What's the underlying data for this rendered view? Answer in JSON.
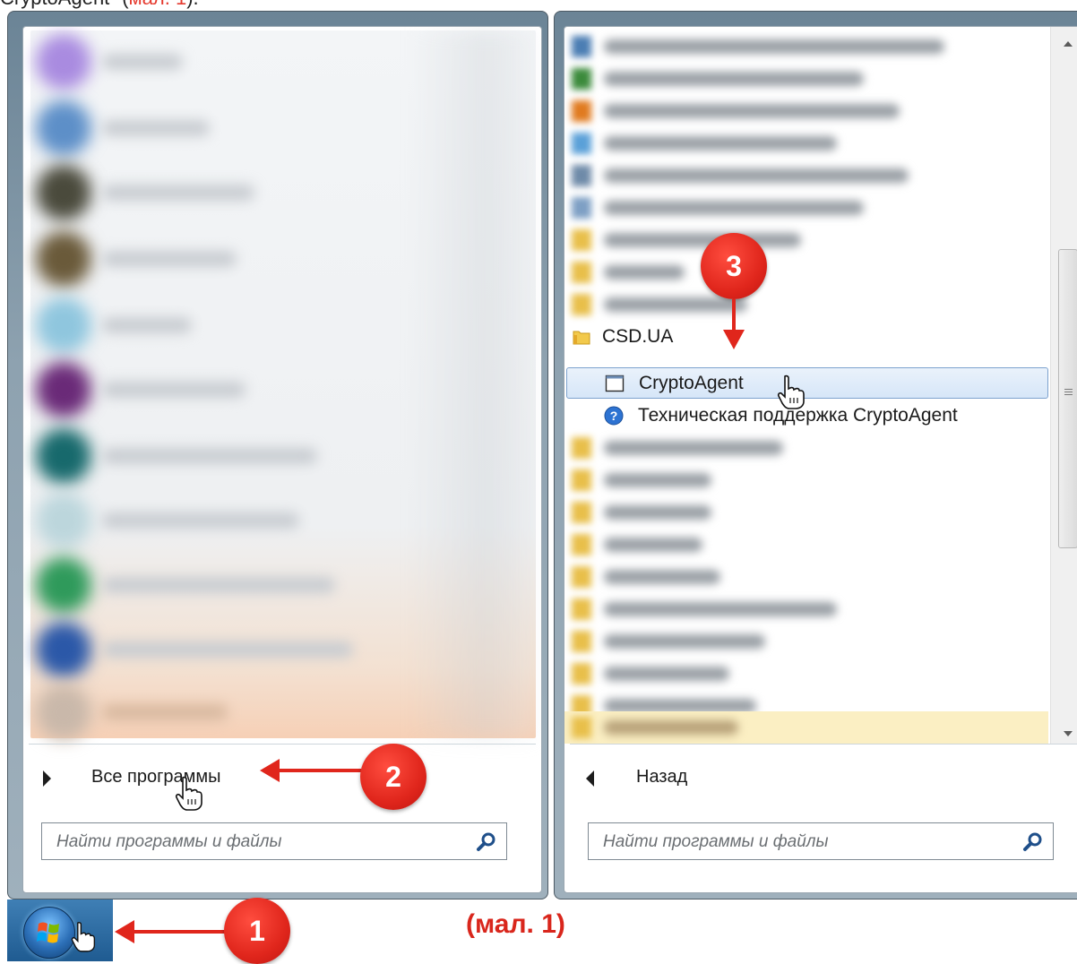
{
  "header_caption": {
    "text": "CryptoAgent\" (",
    "ref": "мал. 1",
    "tail": ")."
  },
  "left_menu": {
    "all_programs_label": "Все программы",
    "search_placeholder": "Найти программы и файлы"
  },
  "right_menu": {
    "folder_label": "CSD.UA",
    "items": [
      {
        "label": "CryptoAgent",
        "icon": "window-icon",
        "selected": true
      },
      {
        "label": "Техническая поддержка CryptoAgent",
        "icon": "help-icon",
        "selected": false
      }
    ],
    "back_label": "Назад",
    "search_placeholder": "Найти программы и файлы"
  },
  "callouts": {
    "one": "1",
    "two": "2",
    "three": "3"
  },
  "figure_caption": "(мал. 1)",
  "colors": {
    "callout_red": "#e0261c",
    "selection_border": "#7da2ce",
    "folder_yellow": "#f2c94c",
    "help_blue": "#2d73d2"
  }
}
